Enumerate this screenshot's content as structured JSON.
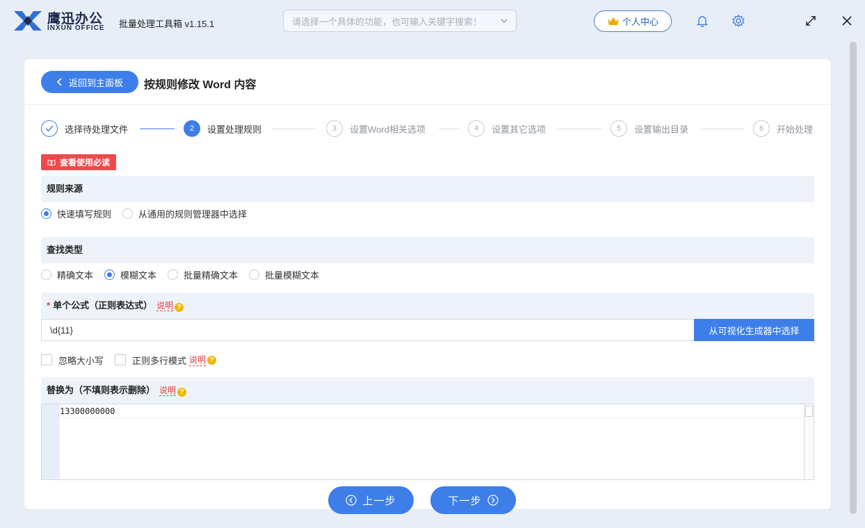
{
  "app": {
    "logo_cn": "鹰迅办公",
    "logo_en": "INXUN OFFICE",
    "title": "批量处理工具箱 v1.15.1"
  },
  "search": {
    "placeholder": "请选择一个具体的功能，也可输入关键字搜索！"
  },
  "header": {
    "user_center": "个人中心",
    "icons": [
      "bell-icon",
      "gear-icon",
      "maximize-icon",
      "close-icon"
    ]
  },
  "page": {
    "back_label": "返回到主面板",
    "title": "按规则修改 Word 内容"
  },
  "steps": [
    {
      "num": "",
      "label": "选择待处理文件",
      "state": "done"
    },
    {
      "num": "2",
      "label": "设置处理规则",
      "state": "active"
    },
    {
      "num": "3",
      "label": "设置Word相关选项",
      "state": "pending"
    },
    {
      "num": "4",
      "label": "设置其它选项",
      "state": "pending"
    },
    {
      "num": "5",
      "label": "设置输出目录",
      "state": "pending"
    },
    {
      "num": "6",
      "label": "开始处理",
      "state": "pending"
    }
  ],
  "guide_label": "查看使用必读",
  "rule_source": {
    "title": "规则来源",
    "options": [
      "快速填写规则",
      "从通用的规则管理器中选择"
    ],
    "selected": 0
  },
  "search_type": {
    "title": "查找类型",
    "options": [
      "精确文本",
      "模糊文本",
      "批量精确文本",
      "批量模糊文本"
    ],
    "selected": 1
  },
  "formula": {
    "required_mark": "*",
    "title": "单个公式（正则表达式）",
    "help": "说明",
    "value": "\\d{11}",
    "generator_label": "从可视化生成器中选择"
  },
  "checks": {
    "ignore_case": "忽略大小写",
    "multiline": "正则多行模式",
    "help": "说明"
  },
  "replace": {
    "title": "替换为（不填则表示删除）",
    "help": "说明",
    "value": "13300000000"
  },
  "nav": {
    "prev": "上一步",
    "next": "下一步"
  },
  "colors": {
    "accent": "#3d7ee9",
    "danger": "#f0494c",
    "help_icon": "#f2b705"
  }
}
